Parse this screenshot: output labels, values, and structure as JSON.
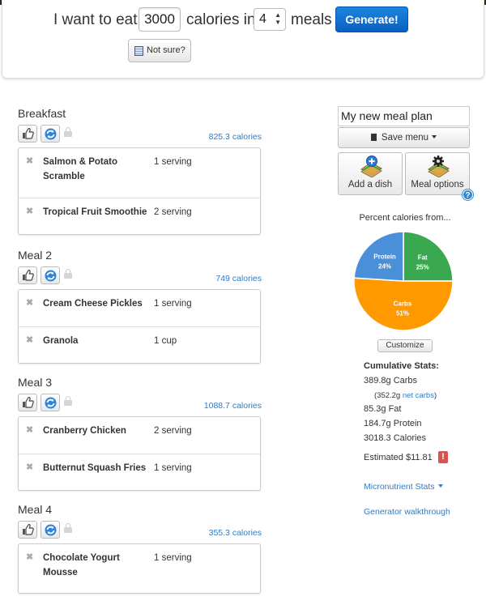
{
  "hero": {
    "text_before": "I want to eat",
    "calories_value": "3000",
    "text_middle": "calories in",
    "meals_value": "4",
    "text_after": "meals",
    "generate_label": "Generate!",
    "not_sure_label": "Not sure?"
  },
  "meals": [
    {
      "title": "Breakfast",
      "calories": "825.3 calories",
      "items": [
        {
          "name": "Salmon & Potato Scramble",
          "qty": "1 serving"
        },
        {
          "name": "Tropical Fruit Smoothie",
          "qty": "2 serving"
        }
      ]
    },
    {
      "title": "Meal 2",
      "calories": "749 calories",
      "items": [
        {
          "name": "Cream Cheese Pickles",
          "qty": "1 serving"
        },
        {
          "name": "Granola",
          "qty": "1 cup"
        }
      ]
    },
    {
      "title": "Meal 3",
      "calories": "1088.7 calories",
      "items": [
        {
          "name": "Cranberry Chicken",
          "qty": "2 serving"
        },
        {
          "name": "Butternut Squash Fries",
          "qty": "1 serving"
        }
      ]
    },
    {
      "title": "Meal 4",
      "calories": "355.3 calories",
      "items": [
        {
          "name": "Chocolate Yogurt Mousse",
          "qty": "1 serving"
        }
      ]
    }
  ],
  "sidebar": {
    "plan_name": "My new meal plan",
    "save_menu_label": "Save menu",
    "add_dish_label": "Add a dish",
    "meal_options_label": "Meal options",
    "help_label": "?",
    "pie_title": "Percent calories from...",
    "customize_label": "Customize",
    "stats_title": "Cumulative Stats:",
    "carbs": "389.8g Carbs",
    "net_carbs_prefix": "(352.2g",
    "net_carbs_link": "net carbs",
    "net_carbs_suffix": ")",
    "fat": "85.3g Fat",
    "protein": "184.7g Protein",
    "calories": "3018.3 Calories",
    "estimated": "Estimated $11.81",
    "warning": "!",
    "micronutrient_label": "Micronutrient Stats",
    "walkthrough_label": "Generator walkthrough"
  },
  "chart_data": {
    "type": "pie",
    "title": "Percent calories from...",
    "slices": [
      {
        "name": "Protein",
        "value": 24,
        "label": "24%",
        "color": "#4a90d9"
      },
      {
        "name": "Fat",
        "value": 25,
        "label": "25%",
        "color": "#3aa84e"
      },
      {
        "name": "Carbs",
        "value": 51,
        "label": "51%",
        "color": "#ff9900"
      }
    ]
  }
}
